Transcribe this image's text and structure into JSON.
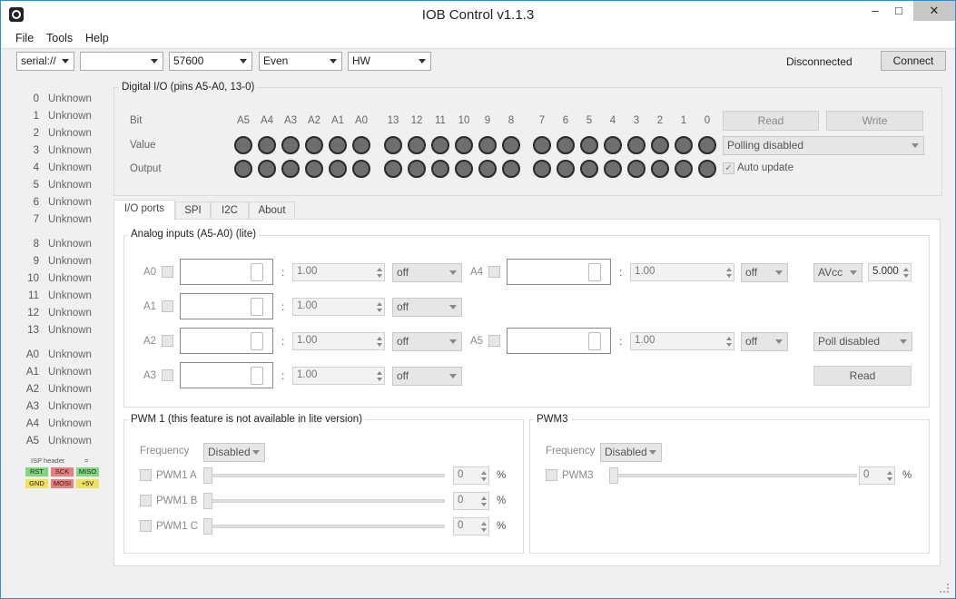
{
  "window": {
    "title": "IOB Control v1.1.3",
    "minimize": "–",
    "maximize": "□",
    "close": "✕"
  },
  "menu": [
    "File",
    "Tools",
    "Help"
  ],
  "toolbar": {
    "port": "serial://",
    "device": "",
    "baud": "57600",
    "parity": "Even",
    "flow": "HW",
    "status": "Disconnected",
    "connect_label": "Connect"
  },
  "pins": [
    {
      "num": "0",
      "state": "Unknown"
    },
    {
      "num": "1",
      "state": "Unknown"
    },
    {
      "num": "2",
      "state": "Unknown"
    },
    {
      "num": "3",
      "state": "Unknown"
    },
    {
      "num": "4",
      "state": "Unknown"
    },
    {
      "num": "5",
      "state": "Unknown"
    },
    {
      "num": "6",
      "state": "Unknown"
    },
    {
      "num": "7",
      "state": "Unknown"
    },
    {
      "num": "8",
      "state": "Unknown"
    },
    {
      "num": "9",
      "state": "Unknown"
    },
    {
      "num": "10",
      "state": "Unknown"
    },
    {
      "num": "11",
      "state": "Unknown"
    },
    {
      "num": "12",
      "state": "Unknown"
    },
    {
      "num": "13",
      "state": "Unknown"
    },
    {
      "num": "A0",
      "state": "Unknown"
    },
    {
      "num": "A1",
      "state": "Unknown"
    },
    {
      "num": "A2",
      "state": "Unknown"
    },
    {
      "num": "A3",
      "state": "Unknown"
    },
    {
      "num": "A4",
      "state": "Unknown"
    },
    {
      "num": "A5",
      "state": "Unknown"
    }
  ],
  "isp": {
    "header": "ISP header",
    "eq": "=",
    "cells": [
      {
        "label": "RST",
        "color": "#7fd87f"
      },
      {
        "label": "SCK",
        "color": "#e88080"
      },
      {
        "label": "MISO",
        "color": "#7fd87f"
      },
      {
        "label": "GND",
        "color": "#f0e060"
      },
      {
        "label": "MOSI",
        "color": "#e88080"
      },
      {
        "label": "+5V",
        "color": "#f0e060"
      }
    ]
  },
  "digital": {
    "title": "Digital I/O (pins A5-A0, 13-0)",
    "row_bit": "Bit",
    "row_value": "Value",
    "row_output": "Output",
    "bits": [
      "A5",
      "A4",
      "A3",
      "A2",
      "A1",
      "A0",
      "13",
      "12",
      "11",
      "10",
      "9",
      "8",
      "7",
      "6",
      "5",
      "4",
      "3",
      "2",
      "1",
      "0"
    ],
    "read_label": "Read",
    "write_label": "Write",
    "polling": "Polling disabled",
    "auto_update": "Auto update",
    "auto_check": "✓"
  },
  "tabs": [
    "I/O ports",
    "SPI",
    "I2C",
    "About"
  ],
  "analog": {
    "title": "Analog inputs (A5-A0) (lite)",
    "channels": [
      {
        "label": "A0",
        "factor": "1.00",
        "mode": "off"
      },
      {
        "label": "A1",
        "factor": "1.00",
        "mode": "off"
      },
      {
        "label": "A2",
        "factor": "1.00",
        "mode": "off"
      },
      {
        "label": "A3",
        "factor": "1.00",
        "mode": "off"
      },
      {
        "label": "A4",
        "factor": "1.00",
        "mode": "off"
      },
      {
        "label": "A5",
        "factor": "1.00",
        "mode": "off"
      }
    ],
    "colon": ":",
    "ref": "AVcc",
    "ref_value": "5.000",
    "poll": "Poll disabled",
    "read_label": "Read"
  },
  "pwm1": {
    "title": "PWM 1 (this feature is not available in lite version)",
    "frequency_label": "Frequency",
    "frequency": "Disabled",
    "channels": [
      {
        "label": "PWM1 A",
        "value": "0",
        "unit": "%"
      },
      {
        "label": "PWM1 B",
        "value": "0",
        "unit": "%"
      },
      {
        "label": "PWM1 C",
        "value": "0",
        "unit": "%"
      }
    ]
  },
  "pwm3": {
    "title": "PWM3",
    "frequency_label": "Frequency",
    "frequency": "Disabled",
    "channels": [
      {
        "label": "PWM3",
        "value": "0",
        "unit": "%"
      }
    ]
  }
}
